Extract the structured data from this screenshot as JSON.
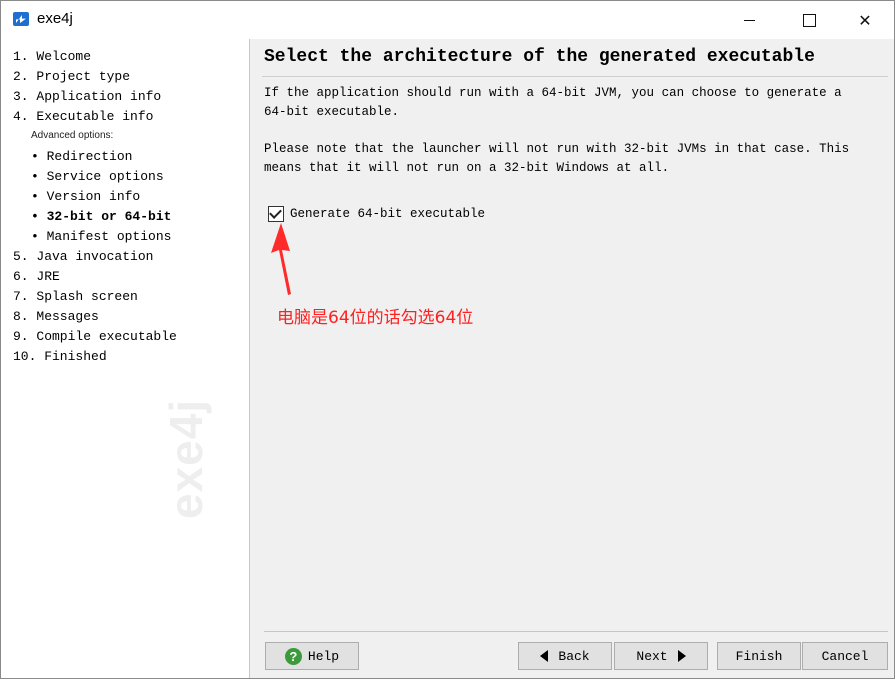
{
  "window": {
    "title": "exe4j"
  },
  "nav": {
    "items": [
      {
        "label": "1. Welcome"
      },
      {
        "label": "2. Project type"
      },
      {
        "label": "3. Application info"
      },
      {
        "label": "4. Executable info"
      },
      {
        "label": "Advanced options:"
      },
      {
        "label": "• Redirection"
      },
      {
        "label": "• Service options"
      },
      {
        "label": "• Version info"
      },
      {
        "label": "• 32-bit or 64-bit"
      },
      {
        "label": "• Manifest options"
      },
      {
        "label": "5. Java invocation"
      },
      {
        "label": "6. JRE"
      },
      {
        "label": "7. Splash screen"
      },
      {
        "label": "8. Messages"
      },
      {
        "label": "9. Compile executable"
      },
      {
        "label": "10. Finished"
      }
    ],
    "watermark": "exe4j"
  },
  "main": {
    "heading": "Select the architecture of the generated executable",
    "para1": "If the application should run with a 64-bit JVM, you can choose to generate a 64-bit executable.",
    "para2": "Please note that the launcher will not run with 32-bit JVMs in that case. This means that it will not run on a 32-bit Windows at all.",
    "checkbox_label": "Generate 64-bit executable",
    "checkbox_checked": true,
    "annotation": "电脑是64位的话勾选64位",
    "annotation_color": "#ff2020"
  },
  "buttons": {
    "help": "Help",
    "back": "Back",
    "next": "Next",
    "finish": "Finish",
    "cancel": "Cancel"
  }
}
